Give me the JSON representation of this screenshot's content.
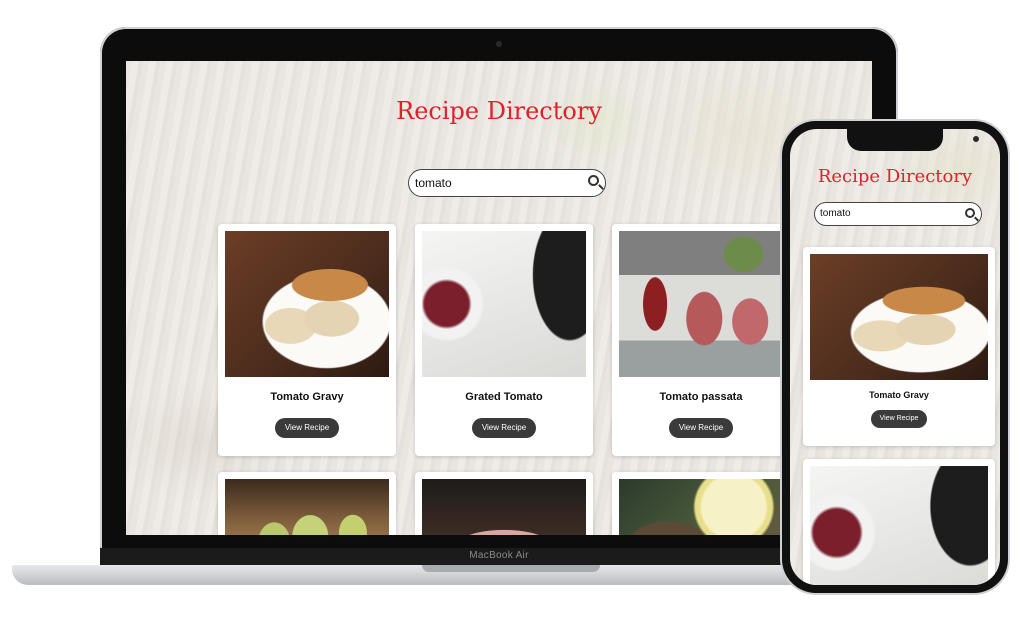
{
  "laptop": {
    "brand_label": "MacBook Air"
  },
  "site": {
    "title": "Recipe Directory",
    "search_value": "tomato",
    "recipes": [
      {
        "title": "Tomato Gravy",
        "button": "View Recipe",
        "image": "tomato-gravy-photo"
      },
      {
        "title": "Grated Tomato",
        "button": "View Recipe",
        "image": "grated-tomato-photo"
      },
      {
        "title": "Tomato passata",
        "button": "View Recipe",
        "image": "tomato-passata-photo"
      },
      {
        "title": "",
        "button": "",
        "image": "avocado-toast-photo"
      },
      {
        "title": "",
        "button": "",
        "image": "tomato-cocktail-photo"
      },
      {
        "title": "",
        "button": "",
        "image": "lemon-dish-photo"
      }
    ]
  },
  "colors": {
    "title_red": "#e0202a",
    "button_dark": "#3a3a3a"
  }
}
